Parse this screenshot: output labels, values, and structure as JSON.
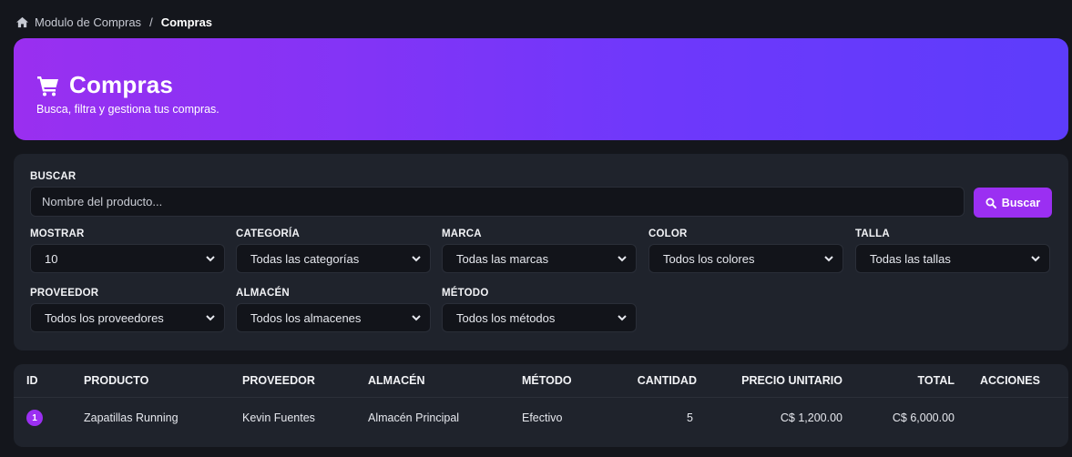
{
  "breadcrumb": {
    "parent": "Modulo de Compras",
    "separator": "/",
    "current": "Compras"
  },
  "hero": {
    "title": "Compras",
    "subtitle": "Busca, filtra y gestiona tus compras."
  },
  "search": {
    "label": "BUSCAR",
    "placeholder": "Nombre del producto...",
    "button": "Buscar"
  },
  "filters": [
    {
      "label": "MOSTRAR",
      "value": "10"
    },
    {
      "label": "CATEGORÍA",
      "value": "Todas las categorías"
    },
    {
      "label": "MARCA",
      "value": "Todas las marcas"
    },
    {
      "label": "COLOR",
      "value": "Todos los colores"
    },
    {
      "label": "TALLA",
      "value": "Todas las tallas"
    },
    {
      "label": "PROVEEDOR",
      "value": "Todos los proveedores"
    },
    {
      "label": "ALMACÉN",
      "value": "Todos los almacenes"
    },
    {
      "label": "MÉTODO",
      "value": "Todos los métodos"
    }
  ],
  "table": {
    "columns": [
      "ID",
      "PRODUCTO",
      "PROVEEDOR",
      "ALMACÉN",
      "MÉTODO",
      "CANTIDAD",
      "PRECIO UNITARIO",
      "TOTAL",
      "ACCIONES"
    ],
    "rows": [
      {
        "id": "1",
        "producto": "Zapatillas Running",
        "proveedor": "Kevin Fuentes",
        "almacen": "Almacén Principal",
        "metodo": "Efectivo",
        "cantidad": "5",
        "precio": "C$ 1,200.00",
        "total": "C$ 6,000.00"
      }
    ]
  },
  "colors": {
    "accent": "#9b2ff2",
    "gradient_end": "#5d3cfb",
    "background": "#14161c",
    "card": "#1f232c"
  }
}
